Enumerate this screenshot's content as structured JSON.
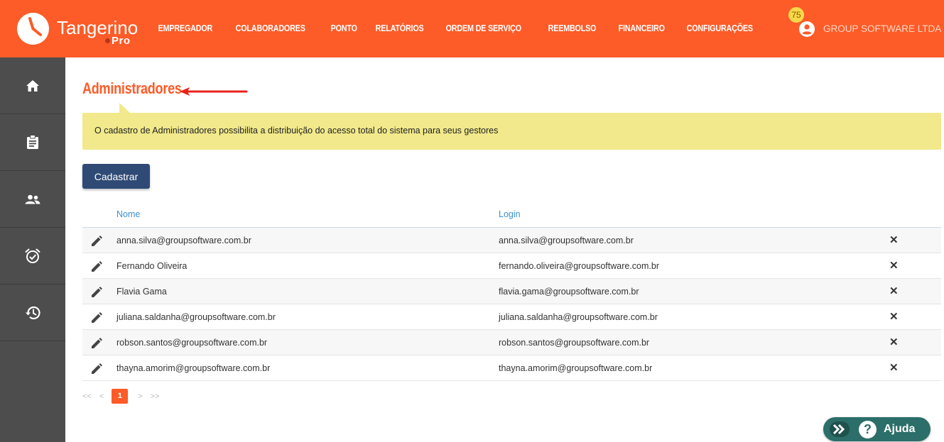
{
  "header": {
    "brand": "Tangerino",
    "brand_sub": "Pro",
    "nav": [
      "EMPREGADOR",
      "COLABORADORES",
      "PONTO",
      "RELATÓRIOS",
      "ORDEM DE SERVIÇO",
      "REEMBOLSO",
      "FINANCEIRO",
      "CONFIGURAÇÕES"
    ],
    "notification_count": "75",
    "company": "GROUP SOFTWARE LTDA"
  },
  "sidebar": {
    "icons": [
      "home-icon",
      "clipboard-icon",
      "people-icon",
      "alarm-check-icon",
      "history-icon"
    ]
  },
  "main": {
    "title": "Administradores",
    "info": "O cadastro de Administradores possibilita a distribuição do acesso total do sistema para seus gestores",
    "register_button": "Cadastrar",
    "columns": {
      "name": "Nome",
      "login": "Login"
    },
    "rows": [
      {
        "name": "anna.silva@groupsoftware.com.br",
        "login": "anna.silva@groupsoftware.com.br",
        "delete": "✕"
      },
      {
        "name": "Fernando Oliveira",
        "login": "fernando.oliveira@groupsoftware.com.br",
        "delete": "✕"
      },
      {
        "name": "Flavia Gama",
        "login": "flavia.gama@groupsoftware.com.br",
        "delete": "✕"
      },
      {
        "name": "juliana.saldanha@groupsoftware.com.br",
        "login": "juliana.saldanha@groupsoftware.com.br",
        "delete": "✕"
      },
      {
        "name": "robson.santos@groupsoftware.com.br",
        "login": "robson.santos@groupsoftware.com.br",
        "delete": "✕"
      },
      {
        "name": "thayna.amorim@groupsoftware.com.br",
        "login": "thayna.amorim@groupsoftware.com.br",
        "delete": "✕"
      }
    ]
  },
  "pagination": {
    "first": "<<",
    "prev": "<",
    "current": "1",
    "next": ">",
    "last": ">>"
  },
  "help": {
    "label": "Ajuda",
    "symbol": "?"
  },
  "colors": {
    "brand": "#fd5b27",
    "sidebar": "#4d4d4d",
    "info_bg": "#f1e98b",
    "button": "#2f4a75",
    "help": "#2c6e69"
  }
}
